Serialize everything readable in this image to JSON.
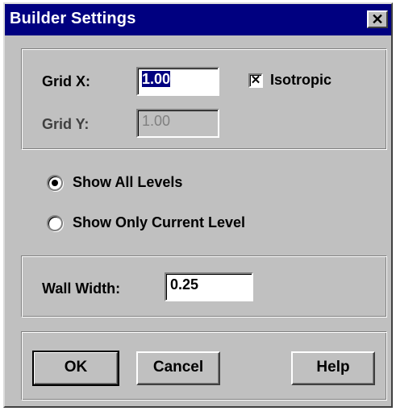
{
  "window": {
    "title": "Builder Settings",
    "close_glyph": "✕"
  },
  "grid": {
    "x_label": "Grid X:",
    "x_value": "1.00",
    "y_label": "Grid Y:",
    "y_value": "1.00",
    "isotropic_label": "Isotropic",
    "isotropic_checked": true,
    "check_glyph": "✕"
  },
  "levels": {
    "show_all_label": "Show All Levels",
    "show_current_label": "Show Only Current Level",
    "selected": "show_all"
  },
  "wall": {
    "label": "Wall Width:",
    "value": "0.25"
  },
  "buttons": {
    "ok": "OK",
    "cancel": "Cancel",
    "help": "Help"
  },
  "colors": {
    "titlebar": "#000080",
    "face": "#c0c0c0",
    "selection": "#000080"
  },
  "icons": {
    "close": "close-icon",
    "checkbox": "check-mark-icon",
    "radio": "radio-dot-icon"
  }
}
